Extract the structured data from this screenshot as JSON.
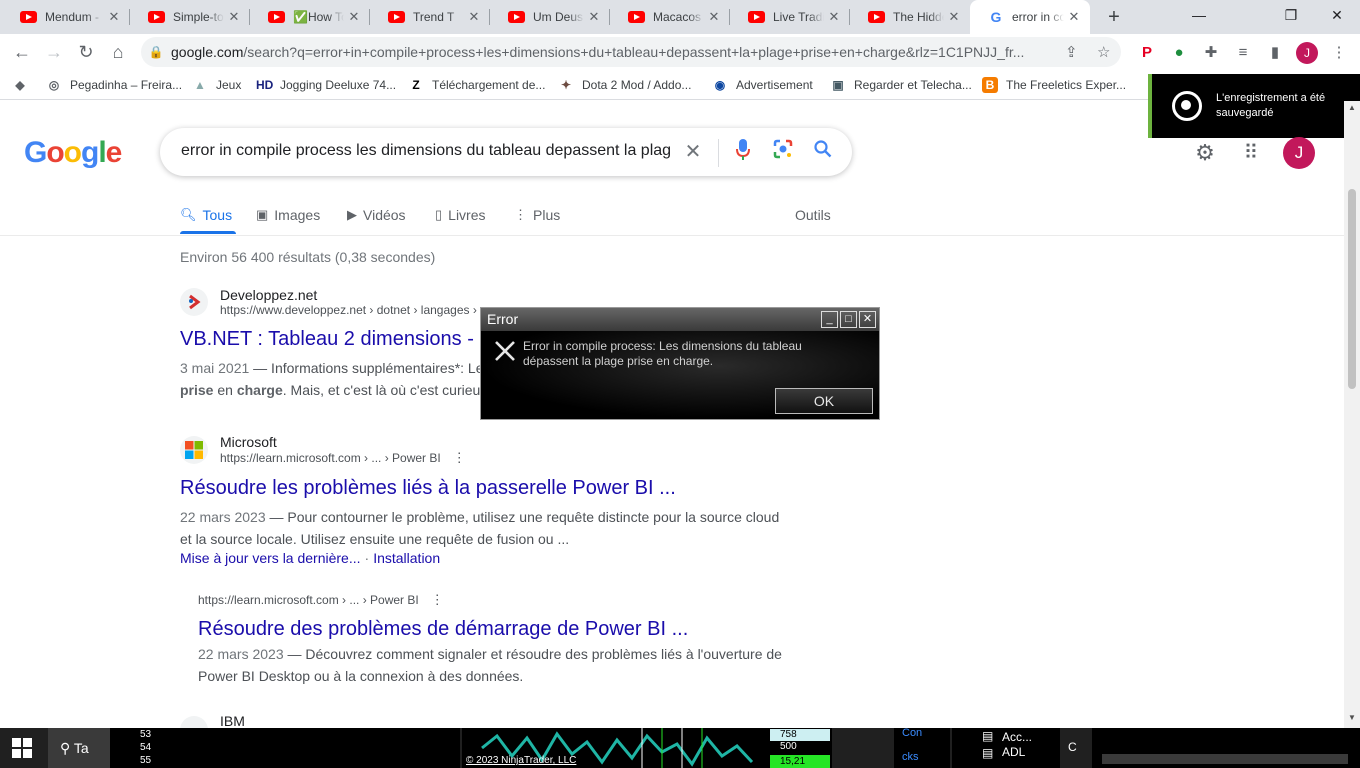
{
  "browser": {
    "tabs": [
      {
        "title": "Mendum -",
        "type": "youtube"
      },
      {
        "title": "Simple-to-",
        "type": "youtube"
      },
      {
        "title": "✅How To",
        "type": "youtube"
      },
      {
        "title": "Trend T",
        "type": "youtube"
      },
      {
        "title": "Um Deus f",
        "type": "youtube"
      },
      {
        "title": "Macacos C",
        "type": "youtube"
      },
      {
        "title": "Live Tradin",
        "type": "youtube"
      },
      {
        "title": "The Hidde",
        "type": "youtube"
      },
      {
        "title": "error in co",
        "type": "google",
        "active": true
      }
    ],
    "url_host": "google.com",
    "url_path": "/search?q=error+in+compile+process+les+dimensions+du+tableau+depassent+la+plage+prise+en+charge&rlz=1C1PNJJ_fr...",
    "profile_initial": "J",
    "bookmarks": [
      "Pegadinha – Freira...",
      "Jeux",
      "Jogging Deeluxe 74...",
      "Téléchargement de...",
      "Dota 2 Mod / Addo...",
      "Advertisement",
      "Regarder et Telecha...",
      "The Freeletics Exper..."
    ]
  },
  "toast": {
    "line1": "L'enregistrement a été",
    "line2": "sauvegardé"
  },
  "google": {
    "logo": "Google",
    "query": "error in compile process les dimensions du tableau depassent la plag",
    "filters": {
      "all": "Tous",
      "images": "Images",
      "videos": "Vidéos",
      "books": "Livres",
      "more": "Plus",
      "tools": "Outils"
    },
    "stats": "Environ 56 400 résultats (0,38 secondes)",
    "profile_initial": "J",
    "results": [
      {
        "site": "Developpez.net",
        "cite": "https://www.developpez.net › dotnet › langages ›",
        "title": "VB.NET : Tableau 2 dimensions -",
        "date": "3 mai 2021",
        "snippet_1": " — Informations supplémentaires*: Le",
        "snippet_2a": "prise",
        "snippet_2b": " en ",
        "snippet_2c": "charge",
        "snippet_2d": ". Mais, et c'est là où c'est curieu"
      },
      {
        "site": "Microsoft",
        "cite": "https://learn.microsoft.com › ... › Power BI",
        "title": "Résoudre les problèmes liés à la passerelle Power BI ...",
        "date": "22 mars 2023",
        "snippet_1": " — Pour contourner le problème, utilisez une requête distincte pour la source cloud",
        "snippet_2": "et la source locale. Utilisez ensuite une requête de fusion ou ...",
        "sublink_1": "Mise à jour vers la dernière...",
        "sublink_sep": "·",
        "sublink_2": "Installation"
      },
      {
        "cite": "https://learn.microsoft.com › ... › Power BI",
        "title": "Résoudre des problèmes de démarrage de Power BI ...",
        "date": "22 mars 2023",
        "snippet_1": " — Découvrez comment signaler et résoudre des problèmes liés à l'ouverture de",
        "snippet_2": "Power BI Desktop ou à la connexion à des données."
      },
      {
        "site": "IBM"
      }
    ]
  },
  "dialog": {
    "title": "Error",
    "message_1": "Error in compile process: Les dimensions du tableau",
    "message_2": "dépassent la plage prise en charge.",
    "ok": "OK"
  },
  "taskbar": {
    "search_text": "Ta",
    "numbers": [
      "53",
      "54",
      "55"
    ],
    "copyright": "© 2023 NinjaTrader, LLC",
    "price_1": "758",
    "price_2": "500",
    "price_3": "15,21",
    "con_1": "Con",
    "con_2": "cks",
    "file_1": "Acc...",
    "file_2": "ADL",
    "c_label": "C"
  }
}
